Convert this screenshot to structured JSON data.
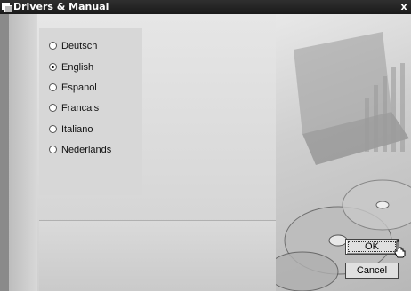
{
  "window": {
    "title": "Drivers & Manual",
    "close_label": "x"
  },
  "languages": [
    {
      "label": "Deutsch",
      "selected": false
    },
    {
      "label": "English",
      "selected": true
    },
    {
      "label": "Espanol",
      "selected": false
    },
    {
      "label": "Francais",
      "selected": false
    },
    {
      "label": "Italiano",
      "selected": false
    },
    {
      "label": "Nederlands",
      "selected": false
    }
  ],
  "buttons": {
    "ok_label": "OK",
    "cancel_label": "Cancel"
  },
  "icons": {
    "app": "app-window-icon",
    "cursor": "hand-pointer-icon"
  }
}
